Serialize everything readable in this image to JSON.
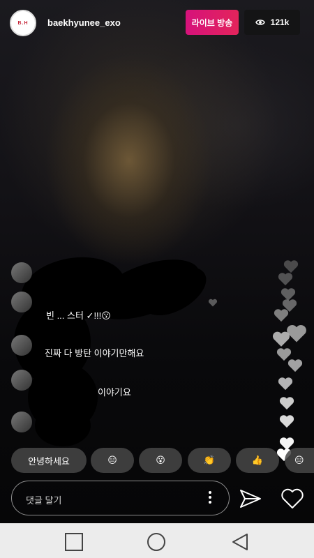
{
  "header": {
    "avatar_text": "B.H",
    "username": "baekhyunee_exo",
    "live_label": "라이브 방송",
    "viewer_count": "121k"
  },
  "comments": [
    {
      "text": "빈 ... 스터 ✓!!!😗"
    },
    {
      "text": "진짜 다 방탄 이야기만해요"
    },
    {
      "text": "이야기요"
    }
  ],
  "quick_replies": [
    "안녕하세요",
    "😑",
    "😮",
    "👏",
    "👍",
    "😑"
  ],
  "comment_input": {
    "placeholder": "댓글 달기"
  },
  "colors": {
    "live_gradient_start": "#d6127b",
    "live_gradient_end": "#e3245b",
    "navbar": "#ececec"
  },
  "icons": [
    "eye-icon",
    "more-vertical-icon",
    "send-icon",
    "heart-icon",
    "square-icon",
    "circle-icon",
    "triangle-back-icon"
  ]
}
